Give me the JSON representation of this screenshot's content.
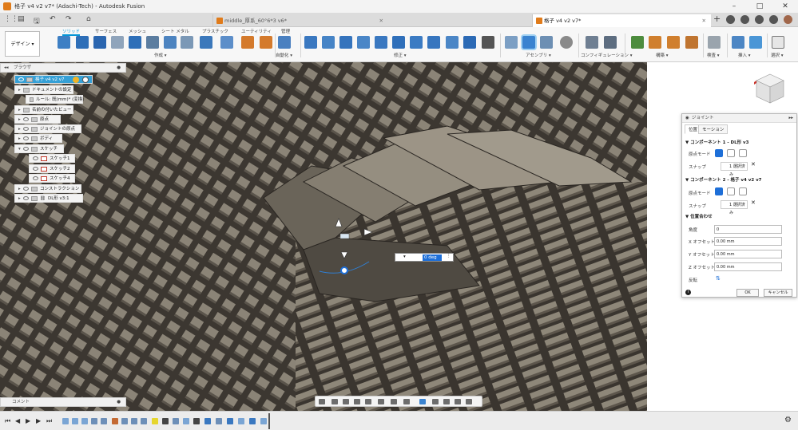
{
  "window": {
    "title": "格子 v4 v2 v7* (Adachi-Tech) - Autodesk Fusion",
    "min": "–",
    "max": "□",
    "close": "✕"
  },
  "tabs": [
    {
      "label": "middle_厚系_60°6*3 v6*",
      "active": false
    },
    {
      "label": "格子 v4 v2 v7*",
      "active": true
    }
  ],
  "quick_access": {
    "grid": "⋮⋮",
    "file": "▤",
    "save": "🖫",
    "undo": "↶",
    "redo": "↷",
    "home": "⌂"
  },
  "ribbon": {
    "workspace": "デザイン ▾",
    "tabs": [
      "ソリッド",
      "サーフェス",
      "メッシュ",
      "シート メタル",
      "プラスチック",
      "ユーティリティ",
      "管理"
    ],
    "active_tab": "ソリッド",
    "groups": [
      "作成 ▾",
      "自動化 ▾",
      "修正 ▾",
      "アセンブリ ▾",
      "コンフィギュレーション ▾",
      "構築 ▾",
      "検査 ▾",
      "挿入 ▾",
      "選択 ▾"
    ]
  },
  "browser": {
    "title": "ブラウザ",
    "items": [
      {
        "label": "格子 v4 v2 v7",
        "level": 0,
        "selected": true
      },
      {
        "label": "ドキュメントの設定",
        "level": 1
      },
      {
        "label": "ルール: 既(mm)* (変換)",
        "level": 2
      },
      {
        "label": "名前の付いたビュー",
        "level": 1
      },
      {
        "label": "原点",
        "level": 1
      },
      {
        "label": "ジョイントの原点",
        "level": 1
      },
      {
        "label": "ボディ",
        "level": 1
      },
      {
        "label": "スケッチ",
        "level": 1
      },
      {
        "label": "スケッチ1",
        "level": 2
      },
      {
        "label": "スケッチ2",
        "level": 2
      },
      {
        "label": "スケッチ4",
        "level": 2
      },
      {
        "label": "コンストラクション",
        "level": 1
      },
      {
        "label": "DL形 v3:1",
        "level": 1
      }
    ]
  },
  "joint_dialog": {
    "title": "ジョイント",
    "tabs": [
      "位置",
      "モーション"
    ],
    "comp1_header": "コンポーネント 1 - DL形 v3",
    "comp2_header": "コンポーネント 2 - 格子 v4 v2 v7",
    "mode_label": "原点モード",
    "snap_label": "スナップ",
    "snap_value": "1 選択済み",
    "align_header": "位置合わせ",
    "angle_label": "角度",
    "angle_value": "0",
    "x_label": "X オフセット",
    "x_value": "0.00 mm",
    "y_label": "Y オフセット",
    "y_value": "0.00 mm",
    "z_label": "Z オフセット",
    "z_value": "0.00 mm",
    "flip_label": "反転",
    "ok": "OK",
    "cancel": "キャンセル"
  },
  "canvas": {
    "angle_value": "0 deg"
  },
  "comment": {
    "label": "コメント"
  },
  "colors": {
    "accent": "#0696d7",
    "model": "#7a7367",
    "model_dark": "#3f3a33",
    "selected": "#36a0d6"
  }
}
